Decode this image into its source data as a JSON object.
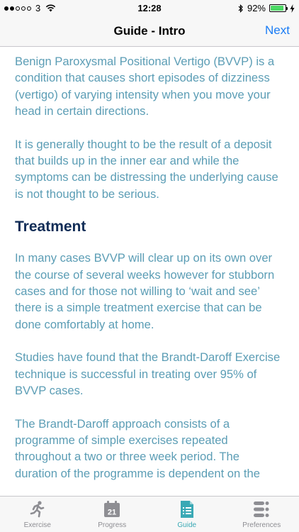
{
  "status": {
    "carrier": "3",
    "time": "12:28",
    "battery": "92%",
    "battery_level": 0.92
  },
  "nav": {
    "title": "Guide - Intro",
    "next_label": "Next"
  },
  "content": {
    "paragraphs_intro": [
      "Benign Paroxysmal Positional Vertigo (BVVP) is a condition that causes short episodes of dizziness (vertigo) of varying intensity when you move your head in certain directions.",
      "It is generally thought to be the result of a deposit that builds up in the inner ear and while the symptoms can be distressing the underlying cause is not thought to be serious."
    ],
    "heading": "Treatment",
    "paragraphs_treatment": [
      "In many cases BVVP will clear up on its own over the course of several weeks however for stubborn cases and for those not willing to ‘wait and see’ there is a simple treatment exercise that can be done comfortably at home.",
      "Studies have found that the Brandt-Daroff Exercise technique is successful in treating over 95% of BVVP cases.",
      "The Brandt-Daroff approach consists of a programme of simple exercises repeated throughout a two or three week period. The duration of the programme is dependent on the"
    ]
  },
  "tabs": [
    {
      "label": "Exercise",
      "icon": "runner-icon"
    },
    {
      "label": "Progress",
      "icon": "calendar-icon",
      "icon_text": "21"
    },
    {
      "label": "Guide",
      "icon": "document-icon"
    },
    {
      "label": "Preferences",
      "icon": "settings-list-icon"
    }
  ],
  "colors": {
    "body_text": "#5b9db5",
    "heading": "#112d57",
    "accent_link": "#1a7cf5",
    "active_tab": "#3aa9b5",
    "inactive_tab": "#8e8e93"
  }
}
